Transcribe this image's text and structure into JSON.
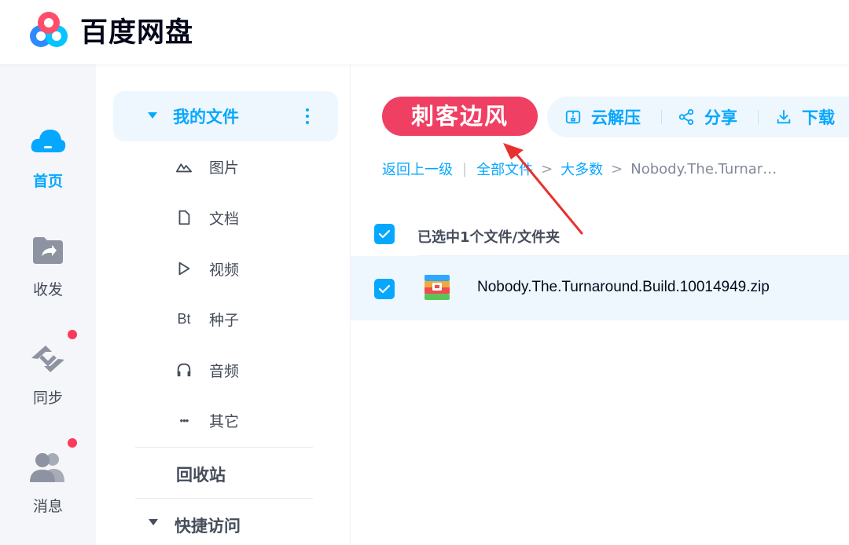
{
  "app": {
    "title": "百度网盘"
  },
  "rail": {
    "items": [
      {
        "label": "首页",
        "icon": "cloud-home-icon",
        "active": true,
        "badge": false
      },
      {
        "label": "收发",
        "icon": "share-folder-icon",
        "active": false,
        "badge": false
      },
      {
        "label": "同步",
        "icon": "sync-icon",
        "active": false,
        "badge": true
      },
      {
        "label": "消息",
        "icon": "users-icon",
        "active": false,
        "badge": true
      }
    ]
  },
  "nav": {
    "my_files": "我的文件",
    "categories": [
      {
        "label": "图片",
        "icon": "image-icon"
      },
      {
        "label": "文档",
        "icon": "document-icon"
      },
      {
        "label": "视频",
        "icon": "video-icon"
      },
      {
        "label": "种子",
        "icon": "torrent-icon",
        "glyph": "Bt"
      },
      {
        "label": "音频",
        "icon": "headphones-icon"
      },
      {
        "label": "其它",
        "icon": "more-icon",
        "glyph": "•••"
      }
    ],
    "recycle": "回收站",
    "quick_access": "快捷访问"
  },
  "main": {
    "watermark": "刺客边风",
    "toolbar": {
      "unzip": "云解压",
      "share": "分享",
      "download": "下载"
    },
    "breadcrumb": {
      "back": "返回上一级",
      "separator": "|",
      "all_files": "全部文件",
      "folder": "大多数",
      "current": "Nobody.The.Turnar…",
      "gt": ">"
    },
    "selection_text": "已选中1个文件/文件夹",
    "files": [
      {
        "name": "Nobody.The.Turnaround.Build.10014949.zip",
        "icon": "zip-archive-icon",
        "checked": true
      }
    ]
  },
  "colors": {
    "accent": "#06a7ff",
    "watermark_bg": "#ef3f63",
    "badge": "#fa3a5b",
    "arrow": "#e8312f"
  }
}
